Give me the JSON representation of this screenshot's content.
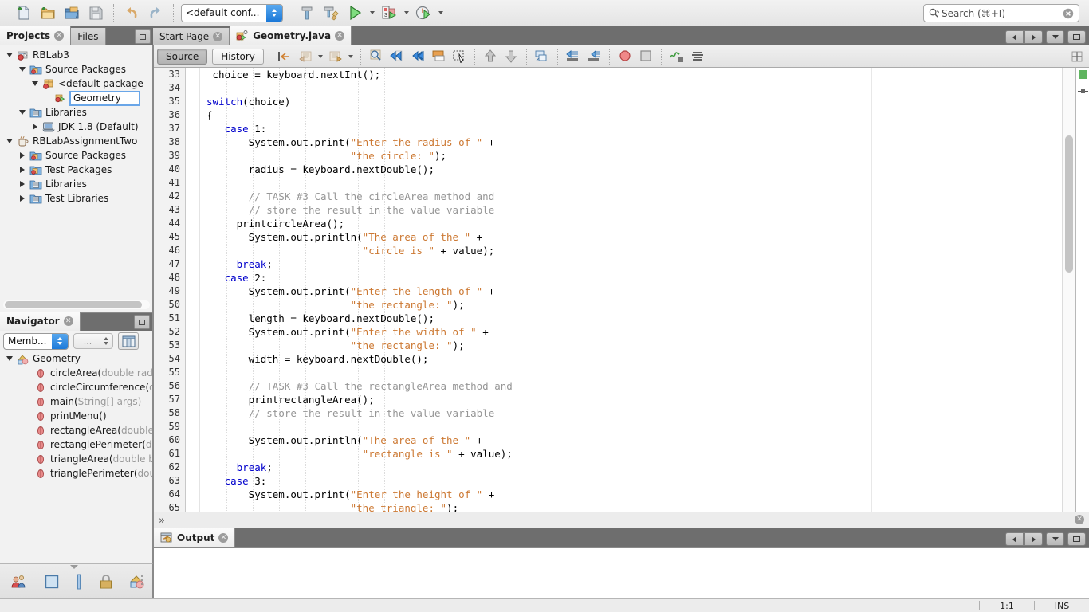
{
  "toolbar": {
    "buttons": [
      {
        "name": "new-file-button",
        "icon": "new-file-icon",
        "label": "New File"
      },
      {
        "name": "new-project-button",
        "icon": "new-project-icon",
        "label": "New Project"
      },
      {
        "name": "open-project-button",
        "icon": "open-project-icon",
        "label": "Open Project"
      },
      {
        "name": "save-all-button",
        "icon": "save-all-icon",
        "label": "Save All"
      },
      {
        "name": "undo-button",
        "icon": "undo-icon",
        "label": "Undo"
      },
      {
        "name": "redo-button",
        "icon": "redo-icon",
        "label": "Redo"
      },
      {
        "name": "build-project-button",
        "icon": "hammer-icon",
        "label": "Build Project"
      },
      {
        "name": "clean-build-button",
        "icon": "hammer-broom-icon",
        "label": "Clean and Build Project"
      },
      {
        "name": "run-project-button",
        "icon": "play-icon",
        "label": "Run Project"
      },
      {
        "name": "debug-project-button",
        "icon": "debug-icon",
        "label": "Debug Project"
      },
      {
        "name": "profile-project-button",
        "icon": "profile-icon",
        "label": "Profile Project"
      }
    ],
    "config_selector": {
      "value": "<default conf...",
      "options": [
        "<default config>"
      ]
    }
  },
  "search": {
    "placeholder": "Search (⌘+I)",
    "value": "",
    "icon": "search-icon",
    "clear_icon": "clear-icon"
  },
  "left_tabs": [
    {
      "label": "Projects",
      "active": true,
      "closable": true
    },
    {
      "label": "Files",
      "active": false,
      "closable": false
    }
  ],
  "editor_tabs": [
    {
      "label": "Start Page",
      "active": false,
      "closable": true,
      "icon": "page-icon"
    },
    {
      "label": "Geometry.java",
      "active": true,
      "closable": true,
      "icon": "java-file-icon"
    }
  ],
  "projects_tree": [
    {
      "indent": 0,
      "twisty": "down",
      "icon": "project-icon",
      "label": "RBLab3",
      "editing": false
    },
    {
      "indent": 1,
      "twisty": "down",
      "icon": "source-folder-icon",
      "label": "Source Packages",
      "editing": false
    },
    {
      "indent": 2,
      "twisty": "down",
      "icon": "package-icon",
      "label": "<default package",
      "editing": false
    },
    {
      "indent": 3,
      "twisty": "none",
      "icon": "java-class-icon",
      "label": "Geometry",
      "editing": true
    },
    {
      "indent": 1,
      "twisty": "down",
      "icon": "libraries-icon",
      "label": "Libraries",
      "editing": false
    },
    {
      "indent": 2,
      "twisty": "right",
      "icon": "jdk-icon",
      "label": "JDK 1.8 (Default)",
      "editing": false
    },
    {
      "indent": 0,
      "twisty": "down",
      "icon": "java-project-icon",
      "label": "RBLabAssignmentTwo",
      "editing": false
    },
    {
      "indent": 1,
      "twisty": "right",
      "icon": "source-folder-icon",
      "label": "Source Packages",
      "editing": false
    },
    {
      "indent": 1,
      "twisty": "right",
      "icon": "source-folder-icon",
      "label": "Test Packages",
      "editing": false
    },
    {
      "indent": 1,
      "twisty": "right",
      "icon": "libraries-icon",
      "label": "Libraries",
      "editing": false
    },
    {
      "indent": 1,
      "twisty": "right",
      "icon": "libraries-icon",
      "label": "Test Libraries",
      "editing": false
    }
  ],
  "navigator": {
    "tab_label": "Navigator",
    "scope_selector": {
      "value": "Memb...",
      "options": [
        "Members View"
      ]
    },
    "filter_selector": {
      "value": "..."
    },
    "filter_button": "filter-icon",
    "tree": [
      {
        "indent": 0,
        "twisty": "down",
        "icon": "class-icon",
        "label": "Geometry",
        "params": ""
      },
      {
        "indent": 1,
        "twisty": "none",
        "icon": "method-icon",
        "label": "circleArea(",
        "params": "double rad"
      },
      {
        "indent": 1,
        "twisty": "none",
        "icon": "method-icon",
        "label": "circleCircumference(",
        "params": "d"
      },
      {
        "indent": 1,
        "twisty": "none",
        "icon": "method-icon",
        "label": "main(",
        "params": "String[] args)"
      },
      {
        "indent": 1,
        "twisty": "none",
        "icon": "method-icon",
        "label": "printMenu()",
        "params": ""
      },
      {
        "indent": 1,
        "twisty": "none",
        "icon": "method-icon",
        "label": "rectangleArea(",
        "params": "double"
      },
      {
        "indent": 1,
        "twisty": "none",
        "icon": "method-icon",
        "label": "rectanglePerimeter(",
        "params": "d"
      },
      {
        "indent": 1,
        "twisty": "none",
        "icon": "method-icon",
        "label": "triangleArea(",
        "params": "double b"
      },
      {
        "indent": 1,
        "twisty": "none",
        "icon": "method-icon",
        "label": "trianglePerimeter(",
        "params": "dou"
      }
    ]
  },
  "bottom_mini_toolbar": [
    {
      "name": "team-icon",
      "label": "Team"
    },
    {
      "name": "square-icon",
      "label": "Panel"
    },
    {
      "name": "bar-icon",
      "label": "Bar"
    },
    {
      "name": "lock-icon",
      "label": "Lock"
    },
    {
      "name": "shapes-icon",
      "label": "Shapes"
    }
  ],
  "editor_toolbar": {
    "source_label": "Source",
    "history_label": "History",
    "buttons": [
      {
        "name": "last-edit-button",
        "icon": "last-edit-icon"
      },
      {
        "name": "back-button",
        "icon": "back-icon",
        "has_arrow": true
      },
      {
        "name": "forward-button",
        "icon": "forward-icon",
        "has_arrow": true
      },
      {
        "name": "find-selection-button",
        "icon": "magnifier-icon"
      },
      {
        "name": "previous-bookmark-button",
        "icon": "blue-left-icon"
      },
      {
        "name": "next-bookmark-button",
        "icon": "blue-right-icon"
      },
      {
        "name": "toggle-bookmark-button",
        "icon": "bookmark-icon"
      },
      {
        "name": "rectangular-selection-button",
        "icon": "rect-select-icon"
      },
      {
        "name": "previous-error-button",
        "icon": "up-arrow-icon"
      },
      {
        "name": "next-error-button",
        "icon": "down-arrow-icon"
      },
      {
        "name": "shift-lines-button",
        "icon": "shift-icon"
      },
      {
        "name": "shift-left-button",
        "icon": "shift-left-icon"
      },
      {
        "name": "shift-right-button",
        "icon": "shift-right-icon"
      },
      {
        "name": "start-macro-recording-button",
        "icon": "record-icon"
      },
      {
        "name": "stop-macro-recording-button",
        "icon": "stop-icon"
      },
      {
        "name": "toggle-highlight-button",
        "icon": "highlight-icon"
      },
      {
        "name": "toggle-line-wrap-button",
        "icon": "wrap-icon"
      }
    ]
  },
  "code": {
    "first_line": 33,
    "lines": [
      {
        "n": 33,
        "tokens": [
          {
            "t": " choice = keyboard.nextInt();",
            "c": "plain"
          }
        ]
      },
      {
        "n": 34,
        "tokens": []
      },
      {
        "n": 35,
        "tokens": [
          {
            "t": "switch",
            "c": "kw"
          },
          {
            "t": "(choice)",
            "c": "plain"
          }
        ]
      },
      {
        "n": 36,
        "tokens": [
          {
            "t": "{",
            "c": "plain"
          }
        ]
      },
      {
        "n": 37,
        "tokens": [
          {
            "t": "   ",
            "c": "plain"
          },
          {
            "t": "case",
            "c": "kw"
          },
          {
            "t": " 1:",
            "c": "plain"
          }
        ]
      },
      {
        "n": 38,
        "tokens": [
          {
            "t": "       System.out.print(",
            "c": "plain"
          },
          {
            "t": "\"Enter the radius of \"",
            "c": "str"
          },
          {
            "t": " +",
            "c": "plain"
          }
        ]
      },
      {
        "n": 39,
        "tokens": [
          {
            "t": "                        ",
            "c": "plain"
          },
          {
            "t": "\"the circle: \"",
            "c": "str"
          },
          {
            "t": ");",
            "c": "plain"
          }
        ]
      },
      {
        "n": 40,
        "tokens": [
          {
            "t": "       radius = keyboard.nextDouble();",
            "c": "plain"
          }
        ]
      },
      {
        "n": 41,
        "tokens": []
      },
      {
        "n": 42,
        "tokens": [
          {
            "t": "       ",
            "c": "plain"
          },
          {
            "t": "// TASK #3 Call the circleArea method and",
            "c": "cmt"
          }
        ]
      },
      {
        "n": 43,
        "tokens": [
          {
            "t": "       ",
            "c": "plain"
          },
          {
            "t": "// store the result in the value variable",
            "c": "cmt"
          }
        ]
      },
      {
        "n": 44,
        "tokens": [
          {
            "t": "     printcircleArea();",
            "c": "plain"
          }
        ]
      },
      {
        "n": 45,
        "tokens": [
          {
            "t": "       System.out.println(",
            "c": "plain"
          },
          {
            "t": "\"The area of the \"",
            "c": "str"
          },
          {
            "t": " +",
            "c": "plain"
          }
        ]
      },
      {
        "n": 46,
        "tokens": [
          {
            "t": "                          ",
            "c": "plain"
          },
          {
            "t": "\"circle is \"",
            "c": "str"
          },
          {
            "t": " + value);",
            "c": "plain"
          }
        ]
      },
      {
        "n": 47,
        "tokens": [
          {
            "t": "     ",
            "c": "plain"
          },
          {
            "t": "break",
            "c": "kw"
          },
          {
            "t": ";",
            "c": "plain"
          }
        ]
      },
      {
        "n": 48,
        "tokens": [
          {
            "t": "   ",
            "c": "plain"
          },
          {
            "t": "case",
            "c": "kw"
          },
          {
            "t": " 2:",
            "c": "plain"
          }
        ]
      },
      {
        "n": 49,
        "tokens": [
          {
            "t": "       System.out.print(",
            "c": "plain"
          },
          {
            "t": "\"Enter the length of \"",
            "c": "str"
          },
          {
            "t": " +",
            "c": "plain"
          }
        ]
      },
      {
        "n": 50,
        "tokens": [
          {
            "t": "                        ",
            "c": "plain"
          },
          {
            "t": "\"the rectangle: \"",
            "c": "str"
          },
          {
            "t": ");",
            "c": "plain"
          }
        ]
      },
      {
        "n": 51,
        "tokens": [
          {
            "t": "       length = keyboard.nextDouble();",
            "c": "plain"
          }
        ]
      },
      {
        "n": 52,
        "tokens": [
          {
            "t": "       System.out.print(",
            "c": "plain"
          },
          {
            "t": "\"Enter the width of \"",
            "c": "str"
          },
          {
            "t": " +",
            "c": "plain"
          }
        ]
      },
      {
        "n": 53,
        "tokens": [
          {
            "t": "                        ",
            "c": "plain"
          },
          {
            "t": "\"the rectangle: \"",
            "c": "str"
          },
          {
            "t": ");",
            "c": "plain"
          }
        ]
      },
      {
        "n": 54,
        "tokens": [
          {
            "t": "       width = keyboard.nextDouble();",
            "c": "plain"
          }
        ]
      },
      {
        "n": 55,
        "tokens": []
      },
      {
        "n": 56,
        "tokens": [
          {
            "t": "       ",
            "c": "plain"
          },
          {
            "t": "// TASK #3 Call the rectangleArea method and",
            "c": "cmt"
          }
        ]
      },
      {
        "n": 57,
        "tokens": [
          {
            "t": "       printrectangleArea();",
            "c": "plain"
          }
        ]
      },
      {
        "n": 58,
        "tokens": [
          {
            "t": "       ",
            "c": "plain"
          },
          {
            "t": "// store the result in the value variable",
            "c": "cmt"
          }
        ]
      },
      {
        "n": 59,
        "tokens": []
      },
      {
        "n": 60,
        "tokens": [
          {
            "t": "       System.out.println(",
            "c": "plain"
          },
          {
            "t": "\"The area of the \"",
            "c": "str"
          },
          {
            "t": " +",
            "c": "plain"
          }
        ]
      },
      {
        "n": 61,
        "tokens": [
          {
            "t": "                          ",
            "c": "plain"
          },
          {
            "t": "\"rectangle is \"",
            "c": "str"
          },
          {
            "t": " + value);",
            "c": "plain"
          }
        ]
      },
      {
        "n": 62,
        "tokens": [
          {
            "t": "     ",
            "c": "plain"
          },
          {
            "t": "break",
            "c": "kw"
          },
          {
            "t": ";",
            "c": "plain"
          }
        ]
      },
      {
        "n": 63,
        "tokens": [
          {
            "t": "   ",
            "c": "plain"
          },
          {
            "t": "case",
            "c": "kw"
          },
          {
            "t": " 3:",
            "c": "plain"
          }
        ]
      },
      {
        "n": 64,
        "tokens": [
          {
            "t": "       System.out.print(",
            "c": "plain"
          },
          {
            "t": "\"Enter the height of \"",
            "c": "str"
          },
          {
            "t": " +",
            "c": "plain"
          }
        ]
      },
      {
        "n": 65,
        "tokens": [
          {
            "t": "                        ",
            "c": "plain"
          },
          {
            "t": "\"the triangle: \"",
            "c": "str"
          },
          {
            "t": ");",
            "c": "plain"
          }
        ]
      }
    ]
  },
  "output": {
    "tab_label": "Output",
    "content": ""
  },
  "status_bar": {
    "position": "1:1",
    "insert_mode": "INS"
  },
  "colors": {
    "keyword": "#0000cc",
    "string": "#cc7832",
    "comment": "#969696",
    "selection_border": "#6aa6e8",
    "tab_strip": "#6e6e6e",
    "panel_bg": "#f2f2f2",
    "annotation_ok": "#5fb55f"
  }
}
